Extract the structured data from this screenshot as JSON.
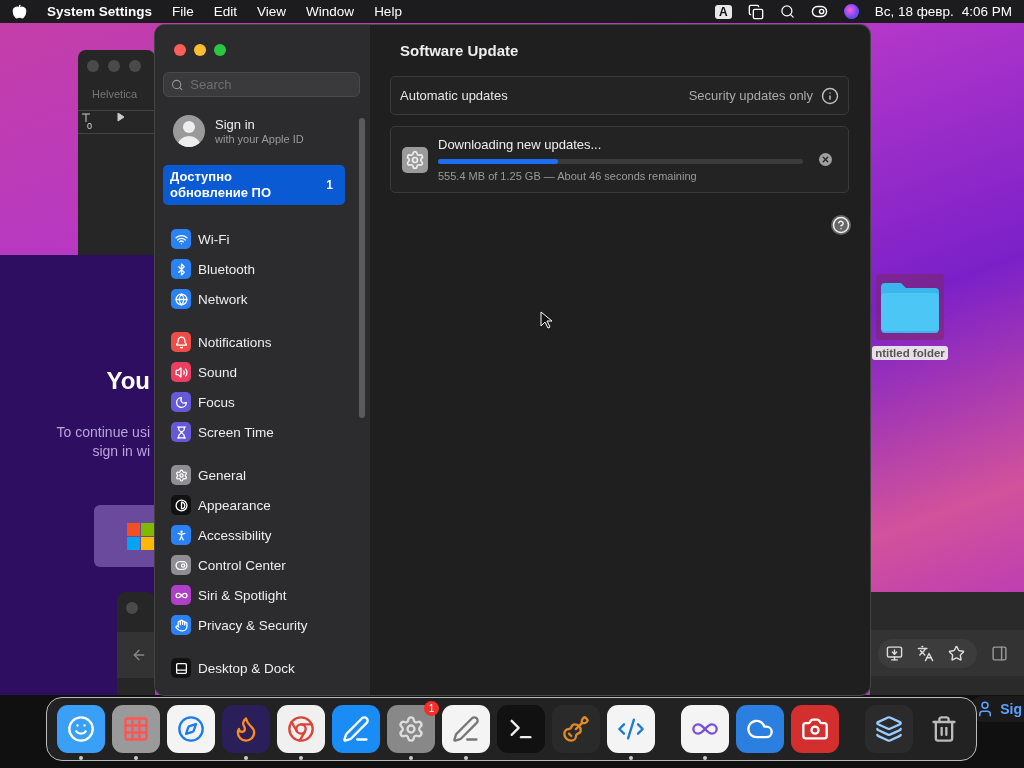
{
  "menu_bar": {
    "app": "System Settings",
    "items": [
      "File",
      "Edit",
      "View",
      "Window",
      "Help"
    ],
    "input_source": "A",
    "date": "Вс, 18 февр.",
    "time": "4:06 PM"
  },
  "font_window": {
    "font": "Helvetica",
    "ruler_mark": "0"
  },
  "sign_in_window": {
    "heading": "You",
    "lines": [
      "To continue usi",
      "sign in wi"
    ]
  },
  "desktop_folder": {
    "label": "ntitled folder",
    "selected": true
  },
  "browser_account": {
    "label": "Sig"
  },
  "settings": {
    "search": {
      "placeholder": "Search"
    },
    "account": {
      "title": "Sign in",
      "subtitle": "with your Apple ID"
    },
    "update_item": {
      "label": "Доступно обновление ПО",
      "badge": "1",
      "selected": true
    },
    "groups": [
      [
        {
          "label": "Wi-Fi",
          "kind": "wifi",
          "color": "#2a83f6"
        },
        {
          "label": "Bluetooth",
          "kind": "bluetooth",
          "color": "#2a83f6"
        },
        {
          "label": "Network",
          "kind": "globe",
          "color": "#2a83f6"
        }
      ],
      [
        {
          "label": "Notifications",
          "kind": "bell",
          "color": "#ee4d47"
        },
        {
          "label": "Sound",
          "kind": "speaker",
          "color": "#ea3f61"
        },
        {
          "label": "Focus",
          "kind": "moon",
          "color": "#6559d8"
        },
        {
          "label": "Screen Time",
          "kind": "hourglass",
          "color": "#6559d8"
        }
      ],
      [
        {
          "label": "General",
          "kind": "gear",
          "color": "#8e8e93"
        },
        {
          "label": "Appearance",
          "kind": "contrast",
          "color": "#111111"
        },
        {
          "label": "Accessibility",
          "kind": "person",
          "color": "#2a83f6"
        },
        {
          "label": "Control Center",
          "kind": "toggles",
          "color": "#8e8e93"
        },
        {
          "label": "Siri & Spotlight",
          "kind": "orb",
          "color": "#b03fc9"
        },
        {
          "label": "Privacy & Security",
          "kind": "hand",
          "color": "#2a83f6"
        }
      ],
      [
        {
          "label": "Desktop & Dock",
          "kind": "dock",
          "color": "#111111"
        }
      ]
    ],
    "main": {
      "title": "Software Update",
      "automatic": {
        "label": "Automatic updates",
        "value": "Security updates only"
      },
      "download": {
        "title": "Downloading new updates...",
        "level": 0.33,
        "detail": "555.4 MB of 1.25 GB — About 46 seconds remaining"
      }
    }
  },
  "dock": [
    {
      "kind": "finder",
      "running": true
    },
    {
      "kind": "launchpad",
      "running": true
    },
    {
      "kind": "safari",
      "running": false
    },
    {
      "kind": "firefox",
      "running": true
    },
    {
      "kind": "chrome",
      "running": true
    },
    {
      "kind": "appstore",
      "running": false
    },
    {
      "kind": "settings",
      "running": true,
      "badge": "1"
    },
    {
      "kind": "textedit",
      "running": true
    },
    {
      "kind": "terminal",
      "running": false
    },
    {
      "kind": "guitar",
      "running": false
    },
    {
      "kind": "code",
      "running": true
    },
    {
      "kind": "separator"
    },
    {
      "kind": "studio",
      "running": true
    },
    {
      "kind": "weather",
      "running": false
    },
    {
      "kind": "photobooth",
      "running": false
    },
    {
      "kind": "separator"
    },
    {
      "kind": "stack",
      "running": false
    },
    {
      "kind": "trash",
      "running": false
    }
  ]
}
